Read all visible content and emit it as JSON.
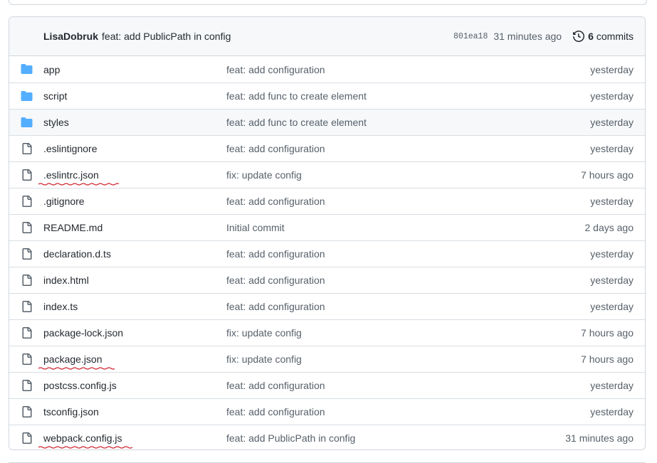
{
  "header": {
    "author": "LisaDobruk",
    "commit_message": "feat: add PublicPath in config",
    "sha": "801ea18",
    "time": "31 minutes ago",
    "commits_count": "6",
    "commits_label": "commits"
  },
  "files": [
    {
      "name": "app",
      "type": "folder",
      "message": "feat: add configuration",
      "date": "yesterday"
    },
    {
      "name": "script",
      "type": "folder",
      "message": "feat: add func to create element",
      "date": "yesterday"
    },
    {
      "name": "styles",
      "type": "folder",
      "message": "feat: add func to create element",
      "date": "yesterday"
    },
    {
      "name": ".eslintignore",
      "type": "file",
      "message": "feat: add configuration",
      "date": "yesterday"
    },
    {
      "name": ".eslintrc.json",
      "type": "file",
      "message": "fix: update config",
      "date": "7 hours ago"
    },
    {
      "name": ".gitignore",
      "type": "file",
      "message": "feat: add configuration",
      "date": "yesterday"
    },
    {
      "name": "README.md",
      "type": "file",
      "message": "Initial commit",
      "date": "2 days ago"
    },
    {
      "name": "declaration.d.ts",
      "type": "file",
      "message": "feat: add configuration",
      "date": "yesterday"
    },
    {
      "name": "index.html",
      "type": "file",
      "message": "feat: add configuration",
      "date": "yesterday"
    },
    {
      "name": "index.ts",
      "type": "file",
      "message": "feat: add configuration",
      "date": "yesterday"
    },
    {
      "name": "package-lock.json",
      "type": "file",
      "message": "fix: update config",
      "date": "7 hours ago"
    },
    {
      "name": "package.json",
      "type": "file",
      "message": "fix: update config",
      "date": "7 hours ago"
    },
    {
      "name": "postcss.config.js",
      "type": "file",
      "message": "feat: add configuration",
      "date": "yesterday"
    },
    {
      "name": "tsconfig.json",
      "type": "file",
      "message": "feat: add configuration",
      "date": "yesterday"
    },
    {
      "name": "webpack.config.js",
      "type": "file",
      "message": "feat: add PublicPath in config",
      "date": "31 minutes ago"
    }
  ],
  "colors": {
    "folder_icon": "#54aeff",
    "file_icon": "#57606a",
    "annotation": "#cf222e"
  }
}
